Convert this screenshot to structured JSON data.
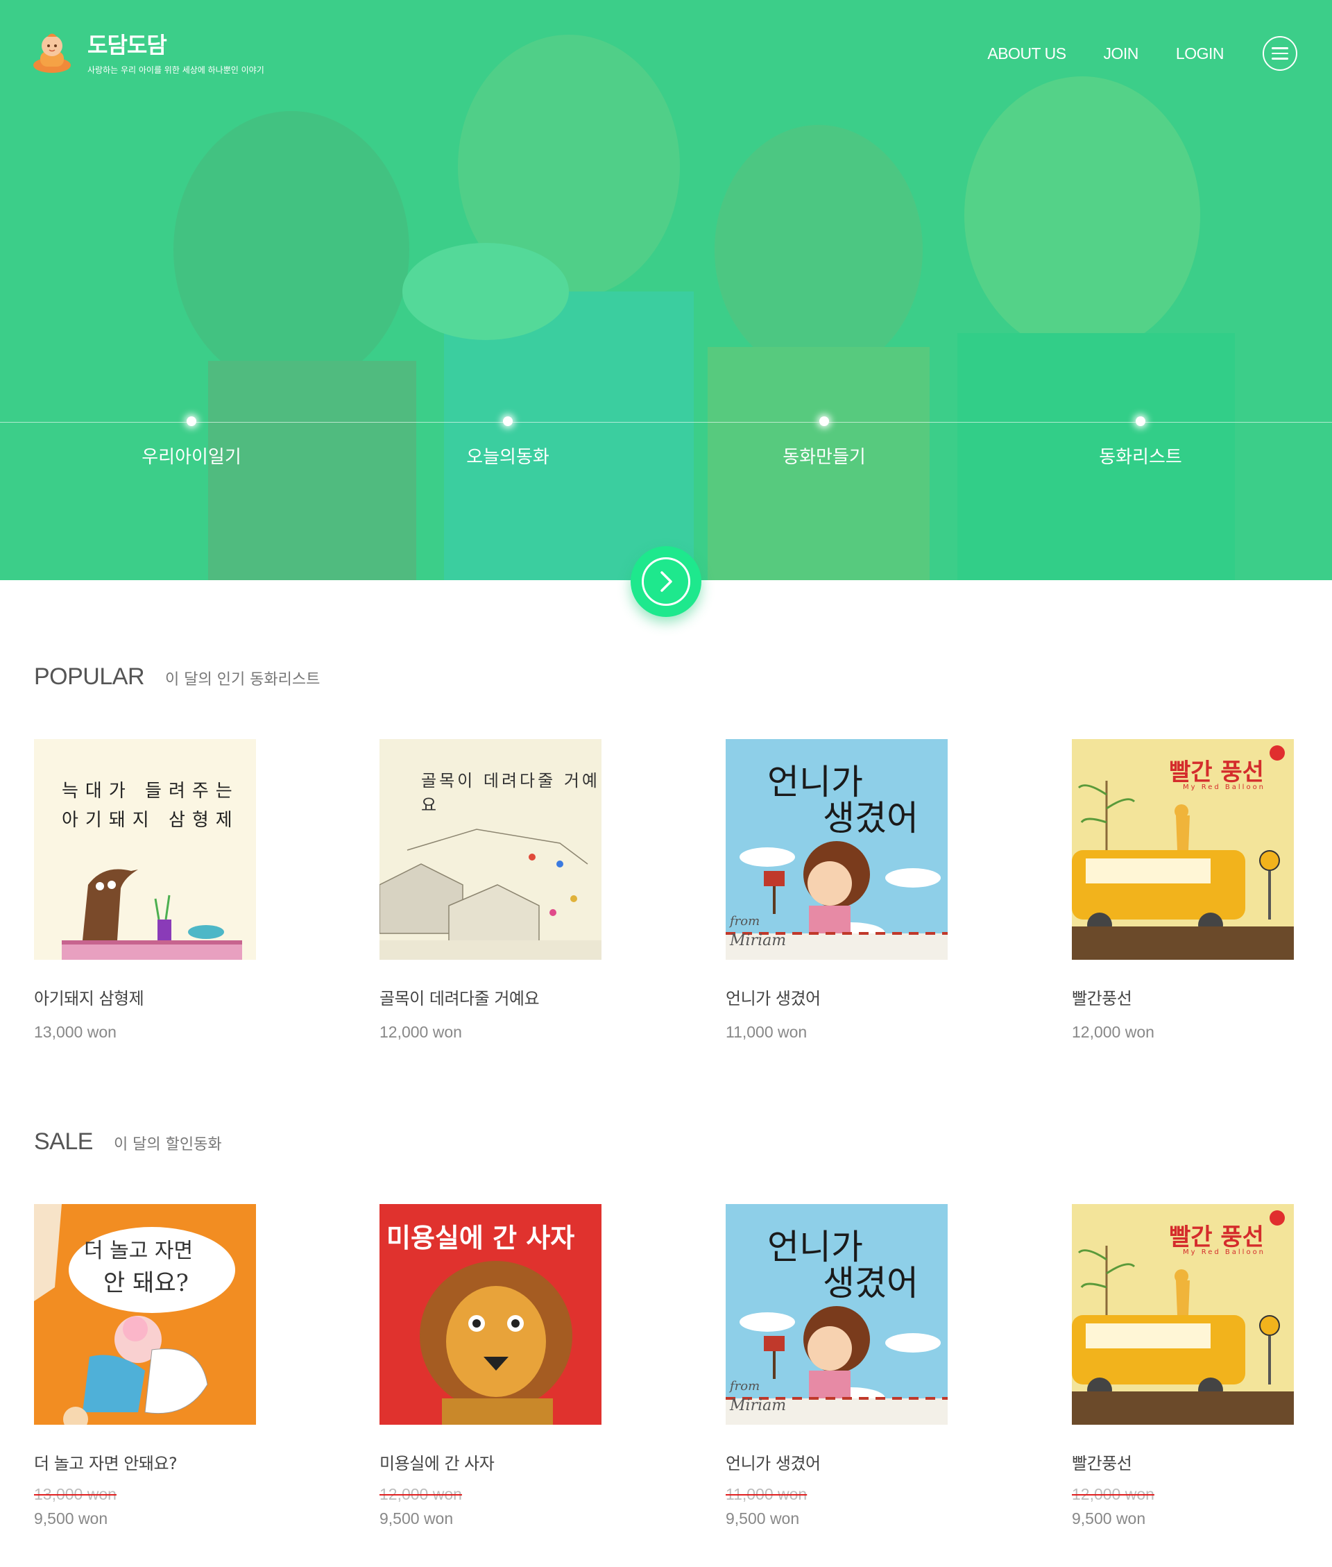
{
  "brand": {
    "name": "도담도담",
    "tagline": "사랑하는 우리 아이를 위한 세상에 하나뿐인 이야기"
  },
  "nav": {
    "links": [
      "ABOUT US",
      "JOIN",
      "LOGIN"
    ],
    "menu_icon": "hamburger-icon"
  },
  "hero": {
    "categories": [
      "우리아이일기",
      "오늘의동화",
      "동화만들기",
      "동화리스트"
    ],
    "next_icon": "chevron-right-icon"
  },
  "popular": {
    "title": "POPULAR",
    "subtitle": "이 달의 인기 동화리스트",
    "items": [
      {
        "name": "아기돼지 삼형제",
        "price": "13,000 won",
        "cover_text": [
          "늑대가 들려주는",
          "아기돼지 삼형제"
        ],
        "cover_bg": "#fbf6e3"
      },
      {
        "name": "골목이 데려다줄 거예요",
        "price": "12,000 won",
        "cover_text": [
          "골목이 데려다줄 거예요"
        ],
        "cover_bg": "#f5f1dc"
      },
      {
        "name": "언니가 생겼어",
        "price": "11,000 won",
        "cover_text": [
          "언니가",
          "생겼어",
          "from",
          "Miriam"
        ],
        "cover_bg": "#8ecfe8"
      },
      {
        "name": "빨간풍선",
        "price": "12,000 won",
        "cover_text": [
          "빨간 풍선",
          "My Red Balloon"
        ],
        "cover_bg": "#f3e49a"
      }
    ]
  },
  "sale": {
    "title": "SALE",
    "subtitle": "이 달의 할인동화",
    "items": [
      {
        "name": "더 놀고 자면 안돼요?",
        "old_price": "13,000 won",
        "price": "9,500 won",
        "cover_text": [
          "더 놀고 자면",
          "안 돼요?"
        ],
        "cover_bg": "#f28d22"
      },
      {
        "name": "미용실에 간 사자",
        "old_price": "12,000 won",
        "price": "9,500 won",
        "cover_text": [
          "미용실에 간 사자"
        ],
        "cover_bg": "#e0322e"
      },
      {
        "name": "언니가 생겼어",
        "old_price": "11,000 won",
        "price": "9,500 won",
        "cover_text": [
          "언니가",
          "생겼어",
          "from",
          "Miriam"
        ],
        "cover_bg": "#8ecfe8"
      },
      {
        "name": "빨간풍선",
        "old_price": "12,000 won",
        "price": "9,500 won",
        "cover_text": [
          "빨간 풍선",
          "My Red Balloon"
        ],
        "cover_bg": "#f3e49a"
      }
    ]
  },
  "colors": {
    "accent": "#2edb91",
    "button": "#1ee88d",
    "strike": "#e02020"
  }
}
